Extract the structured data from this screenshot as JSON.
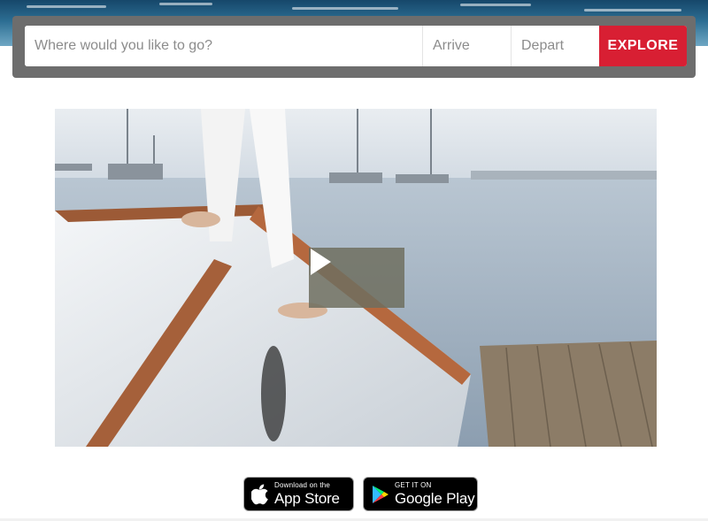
{
  "search": {
    "where_placeholder": "Where would you like to go?",
    "arrive_placeholder": "Arrive",
    "depart_placeholder": "Depart",
    "explore_label": "EXPLORE"
  },
  "video": {
    "play_icon": "play-icon"
  },
  "app_badges": {
    "apple": {
      "small": "Download on the",
      "big": "App Store",
      "icon": "apple-icon"
    },
    "google": {
      "small": "GET IT ON",
      "big": "Google Play",
      "icon": "google-play-icon"
    }
  },
  "colors": {
    "explore_button": "#d81f33",
    "search_shell": "#6d6d6d",
    "hero_water": "#2c6d92"
  }
}
